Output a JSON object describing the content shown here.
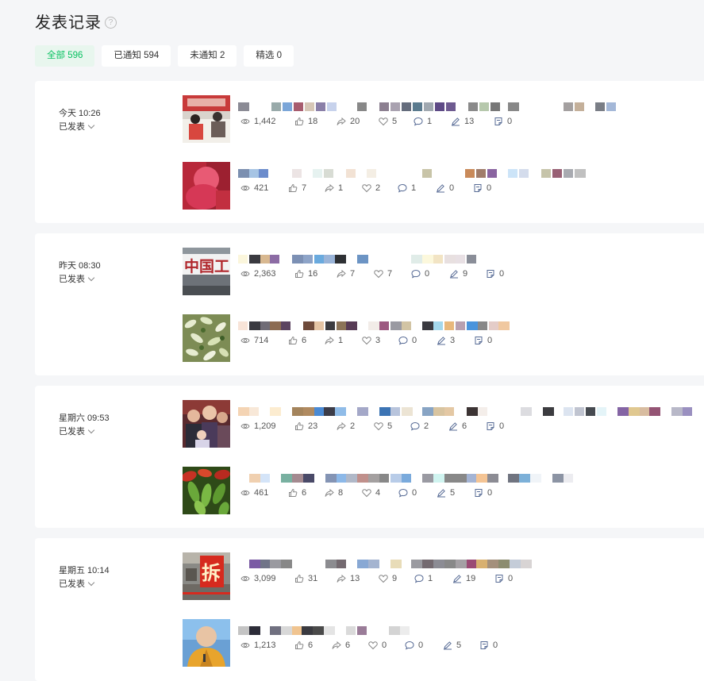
{
  "page": {
    "title": "发表记录",
    "help_icon": "?"
  },
  "tabs": [
    {
      "label": "全部 596",
      "active": true
    },
    {
      "label": "已通知 594",
      "active": false
    },
    {
      "label": "未通知 2",
      "active": false
    },
    {
      "label": "精选 0",
      "active": false
    }
  ],
  "groups": [
    {
      "date": "今天 10:26",
      "status": "已发表",
      "items": [
        {
          "thumb": "thumb-red-office",
          "stats": [
            "1,442",
            "18",
            "20",
            "5",
            "1",
            "13",
            "0"
          ]
        },
        {
          "thumb": "thumb-pink-person",
          "stats": [
            "421",
            "7",
            "1",
            "2",
            "1",
            "0",
            "0"
          ]
        }
      ]
    },
    {
      "date": "昨天 08:30",
      "status": "已发表",
      "items": [
        {
          "thumb": "thumb-bank-sign",
          "thumb_text": "中国工",
          "stats": [
            "2,363",
            "16",
            "7",
            "7",
            "0",
            "9",
            "0"
          ]
        },
        {
          "thumb": "thumb-green-food",
          "stats": [
            "714",
            "6",
            "1",
            "3",
            "0",
            "3",
            "0"
          ]
        }
      ]
    },
    {
      "date": "星期六 09:53",
      "status": "已发表",
      "items": [
        {
          "thumb": "thumb-family-photo",
          "stats": [
            "1,209",
            "23",
            "2",
            "5",
            "2",
            "6",
            "0"
          ]
        },
        {
          "thumb": "thumb-green-peppers",
          "stats": [
            "461",
            "6",
            "8",
            "4",
            "0",
            "5",
            "0"
          ]
        }
      ]
    },
    {
      "date": "星期五 10:14",
      "status": "已发表",
      "items": [
        {
          "thumb": "thumb-demolition-sign",
          "thumb_text": "拆",
          "stats": [
            "3,099",
            "31",
            "13",
            "9",
            "1",
            "19",
            "0"
          ]
        },
        {
          "thumb": "thumb-monk-portrait",
          "stats": [
            "1,213",
            "6",
            "6",
            "0",
            "0",
            "5",
            "0"
          ]
        }
      ]
    }
  ],
  "stat_icons": [
    "eye-icon",
    "thumbs-up-icon",
    "share-icon",
    "heart-icon",
    "comment-icon",
    "pen-icon",
    "quote-icon"
  ],
  "colors": {
    "accent": "#07c160",
    "accent_bg": "#e8f6ee",
    "icon": "#576b95",
    "background": "#f5f6f8"
  }
}
